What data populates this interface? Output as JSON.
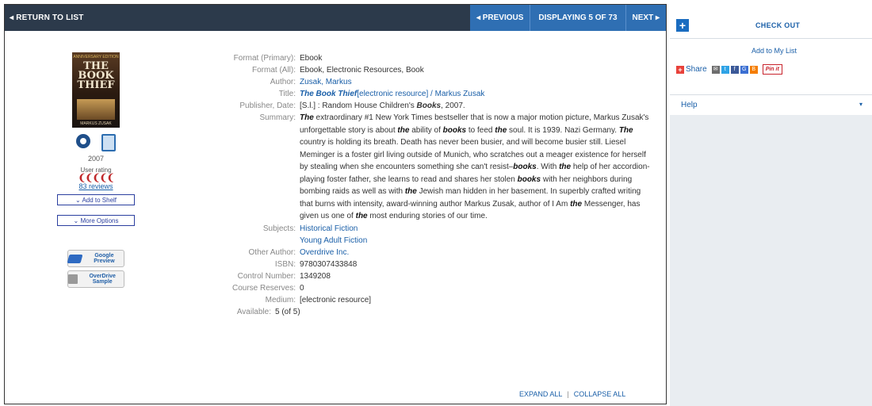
{
  "nav": {
    "return_label": "◂ RETURN TO LIST",
    "prev_label": "◂ PREVIOUS",
    "display_label": "DISPLAYING 5 OF 73",
    "next_label": "NEXT ▸"
  },
  "item": {
    "cover_top": "ANNIVERSARY EDITION",
    "cover_title": "BOOK THIEF",
    "cover_the": "THE",
    "cover_author": "MARKUS ZUSAK",
    "year": "2007",
    "user_rating_label": "User rating",
    "rating_glyphs": "❨❨❨❨❨",
    "rating_value": 4,
    "reviews_label": "83 reviews",
    "add_shelf_label": "⌄ Add to Shelf",
    "more_options_label": "⌄ More Options",
    "google_preview_label": "Google Preview",
    "overdrive_sample_label": "OverDrive Sample"
  },
  "details": {
    "format_primary_label": "Format (Primary):",
    "format_primary": "Ebook",
    "format_all_label": "Format (All):",
    "format_all": "Ebook, Electronic Resources, Book",
    "author_label": "Author:",
    "author": "Zusak, Markus",
    "title_label": "Title:",
    "title_main": "The Book Thief",
    "title_rest": "[electronic resource] / Markus Zusak",
    "publisher_label": "Publisher, Date:",
    "publisher_pre": "[S.l.] : Random House Children's ",
    "publisher_books": "Books",
    "publisher_post": ", 2007.",
    "summary_label": "Summary:",
    "subjects_label": "Subjects:",
    "subject_1": "Historical Fiction",
    "subject_2": "Young Adult Fiction",
    "other_author_label": "Other Author:",
    "other_author": "Overdrive Inc.",
    "isbn_label": "ISBN:",
    "isbn": "9780307433848",
    "control_label": "Control Number:",
    "control": "1349208",
    "course_label": "Course Reserves:",
    "course": "0",
    "medium_label": "Medium:",
    "medium": "[electronic resource]",
    "available_label": "Available:",
    "available": "5 (of 5)"
  },
  "summary_parts": [
    {
      "t": "The",
      "b": true
    },
    {
      "t": " extraordinary #1 New York Times bestseller that is now a major motion picture, Markus Zusak's unforgettable story is about ",
      "b": false
    },
    {
      "t": "the",
      "b": true
    },
    {
      "t": " ability of ",
      "b": false
    },
    {
      "t": "books",
      "b": true
    },
    {
      "t": " to feed ",
      "b": false
    },
    {
      "t": "the",
      "b": true
    },
    {
      "t": " soul. It is 1939. Nazi Germany. ",
      "b": false
    },
    {
      "t": "The",
      "b": true
    },
    {
      "t": " country is holding its breath. Death has never been busier, and will become busier still. Liesel Meminger is a foster girl living outside of Munich, who scratches out a meager existence for herself by stealing when she encounters something she can't resist–",
      "b": false
    },
    {
      "t": "books",
      "b": true
    },
    {
      "t": ". With ",
      "b": false
    },
    {
      "t": "the",
      "b": true
    },
    {
      "t": " help of her accordion-playing foster father, she learns to read and shares her stolen ",
      "b": false
    },
    {
      "t": "books",
      "b": true
    },
    {
      "t": " with her neighbors during bombing raids as well as with ",
      "b": false
    },
    {
      "t": "the",
      "b": true
    },
    {
      "t": " Jewish man hidden in her basement. In superbly crafted writing that burns with intensity, award-winning author Markus Zusak, author of I Am ",
      "b": false
    },
    {
      "t": "the",
      "b": true
    },
    {
      "t": " Messenger, has given us one of ",
      "b": false
    },
    {
      "t": "the",
      "b": true
    },
    {
      "t": " most enduring stories of our time.",
      "b": false
    }
  ],
  "footer": {
    "expand_all": "EXPAND ALL",
    "pipe": "|",
    "collapse_all": "COLLAPSE ALL"
  },
  "sidebar": {
    "checkout_icon": "+",
    "checkout_label": "CHECK OUT",
    "add_to_list": "Add to My List",
    "share_label": "Share",
    "share_icons": [
      "email-icon",
      "twitter-icon",
      "facebook-icon",
      "google-icon",
      "blogger-icon"
    ],
    "pinit_label": "Pin it",
    "help_label": "Help",
    "help_caret": "▾"
  },
  "colors": {
    "topbar": "#2c3a4b",
    "pager": "#2f6fb3",
    "link": "#1a5fa8",
    "rating": "#c0282a",
    "sidebar_bg": "#e9edf1"
  }
}
